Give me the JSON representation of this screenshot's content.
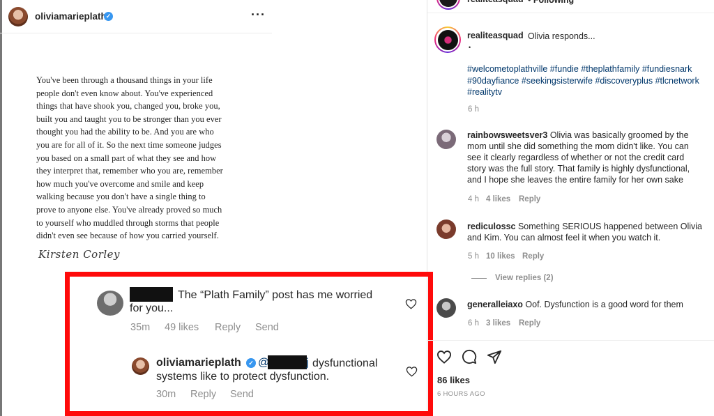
{
  "post_author": {
    "username": "oliviamarieplath",
    "more_icon": "more-horizontal-icon"
  },
  "quote_lines": [
    "You've been through a thousand things in your life",
    "people don't even know about. You've experienced",
    "things that have shook you, changed you, broke you,",
    "built you and taught you to be stronger than you ever",
    "thought you had the ability to be. And you are who",
    "you are for all of it. So the next time someone judges",
    "you based on a small part of what they see and how",
    "they interpret that, remember who you are, remember",
    "how much you've overcome and smile and keep",
    "walking because you don't have a single thing to",
    "prove to anyone else. You've already proved so much",
    "to yourself who muddled through storms that people",
    "didn't even see because of how you carried yourself."
  ],
  "signature": "Kirsten Corley",
  "highlight": {
    "comment": {
      "text_line1": "The “Plath Family” post has me worried",
      "text_line2": "for you...",
      "time": "35m",
      "likes": "49 likes",
      "reply": "Reply",
      "send": "Send"
    },
    "reply": {
      "username": "oliviamarieplath",
      "mention_prefix": "@",
      "mention_suffix": "j",
      "text_line1": "dysfunctional",
      "text_line2": "systems like to protect dysfunction.",
      "time": "30m",
      "reply": "Reply",
      "send": "Send"
    }
  },
  "right": {
    "top_user": "realiteasquad",
    "top_status": "• Following",
    "caption_user": "realiteasquad",
    "caption_text": "Olivia responds...",
    "caption_dot": "•",
    "hashtags_line1": "#welcometoplathville #fundie #theplathfamily #fundiesnark",
    "hashtags_line2": "#90dayfiance #seekingsisterwife #discoveryplus #tlcnetwork",
    "hashtags_line3": "#realitytv",
    "caption_time": "6 h",
    "comments": [
      {
        "username": "rainbowsweetsver3",
        "lines": [
          "Olivia was basically groomed by the",
          "mom until she did something the mom didn't like. You can",
          "see it clearly regardless of whether or not the credit card",
          "story was the full story. That family is highly dysfunctional,",
          "and I hope she leaves the entire family for her own sake"
        ],
        "time": "4 h",
        "likes": "4 likes",
        "reply": "Reply"
      },
      {
        "username": "rediculossc",
        "lines": [
          "Something SERIOUS happened between Olivia",
          "and Kim. You can almost feel it when you watch it."
        ],
        "time": "5 h",
        "likes": "10 likes",
        "reply": "Reply",
        "view_replies": "View replies (2)"
      },
      {
        "username": "generalleiaxo",
        "lines": [
          "Oof. Dysfunction is a good word for them"
        ],
        "time": "6 h",
        "likes": "3 likes",
        "reply": "Reply"
      }
    ],
    "likes_total": "86 likes",
    "posted": "6 HOURS AGO",
    "actions": [
      "heart-icon",
      "comment-icon",
      "share-icon"
    ]
  },
  "colors": {
    "highlight_border": "#ff0a0a",
    "link": "#00376b",
    "verified": "#3897f0",
    "meta": "#8e8e8e"
  }
}
